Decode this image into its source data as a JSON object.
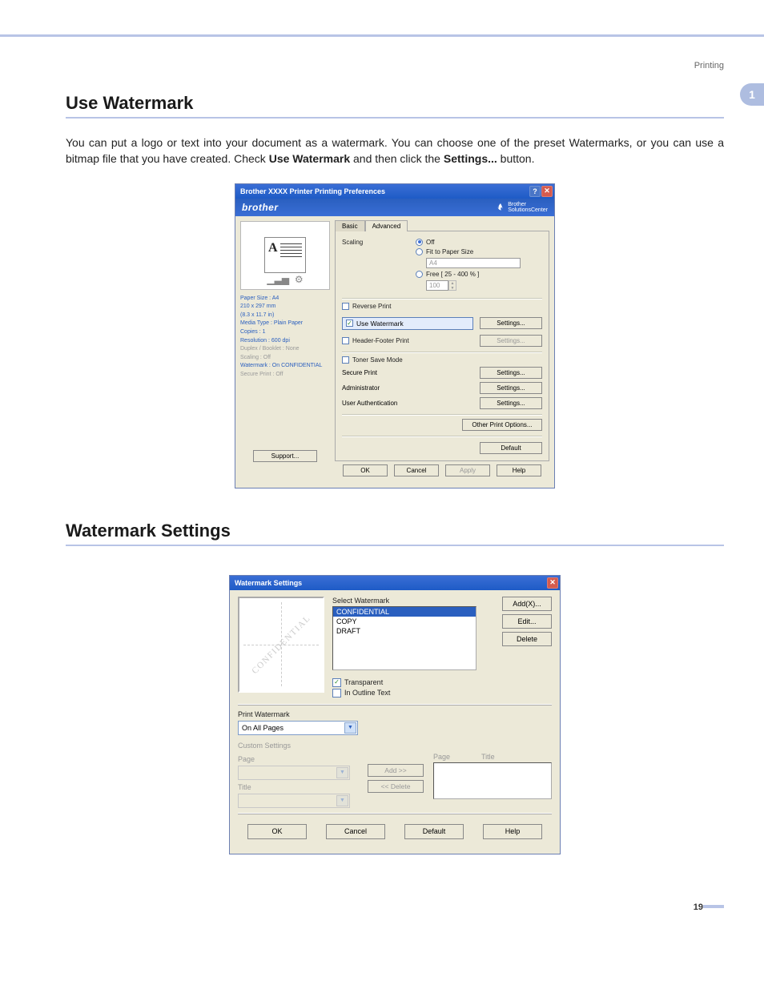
{
  "header": {
    "printing": "Printing"
  },
  "chapter_tab": "1",
  "page_number": "19",
  "section1": {
    "heading": "Use Watermark",
    "para_a": "You can put a logo or text into your document as a watermark. You can choose one of the preset Watermarks, or you can use a bitmap file that you have created. Check ",
    "para_b": "Use Watermark",
    "para_c": " and then click the ",
    "para_d": "Settings...",
    "para_e": " button."
  },
  "section2": {
    "heading": "Watermark Settings"
  },
  "dlg1": {
    "title": "Brother  XXXX    Printer Printing Preferences",
    "brand": "brother",
    "sc1": "Brother",
    "sc2": "SolutionsCenter",
    "info": {
      "l1": "Paper Size : A4",
      "l2": "210 x 297 mm",
      "l3": "(8.3 x 11.7 in)",
      "l4": "Media Type : Plain Paper",
      "l5": "Copies : 1",
      "l6": "Resolution : 600 dpi",
      "l7": "Duplex / Booklet : None",
      "l8": "Scaling : Off",
      "l9": "Watermark : On  CONFIDENTIAL",
      "l10": "Secure Print : Off"
    },
    "support": "Support...",
    "tab_basic": "Basic",
    "tab_adv": "Advanced",
    "scaling": "Scaling",
    "opt_off": "Off",
    "opt_fit": "Fit to Paper Size",
    "fit_value": "A4",
    "opt_free": "Free [ 25 - 400 % ]",
    "free_value": "100",
    "reverse": "Reverse Print",
    "use_wm": "Use Watermark",
    "hf": "Header-Footer Print",
    "tsm": "Toner Save Mode",
    "secure": "Secure Print",
    "admin": "Administrator",
    "userauth": "User Authentication",
    "settings": "Settings...",
    "other": "Other Print Options...",
    "default": "Default",
    "ok": "OK",
    "cancel": "Cancel",
    "apply": "Apply",
    "help": "Help"
  },
  "dlg2": {
    "title": "Watermark Settings",
    "preview_text": "CONFIDENTIAL",
    "sel_label": "Select Watermark",
    "items": {
      "i1": "CONFIDENTIAL",
      "i2": "COPY",
      "i3": "DRAFT"
    },
    "add": "Add(X)...",
    "edit": "Edit...",
    "delete": "Delete",
    "transparent": "Transparent",
    "outline": "In Outline Text",
    "print_wm": "Print Watermark",
    "print_wm_val": "On All Pages",
    "custom": "Custom Settings",
    "page": "Page",
    "title_lbl": "Title",
    "col_page": "Page",
    "col_title": "Title",
    "btn_add": "Add >>",
    "btn_del": "<< Delete",
    "ok": "OK",
    "cancel": "Cancel",
    "default": "Default",
    "help": "Help"
  }
}
